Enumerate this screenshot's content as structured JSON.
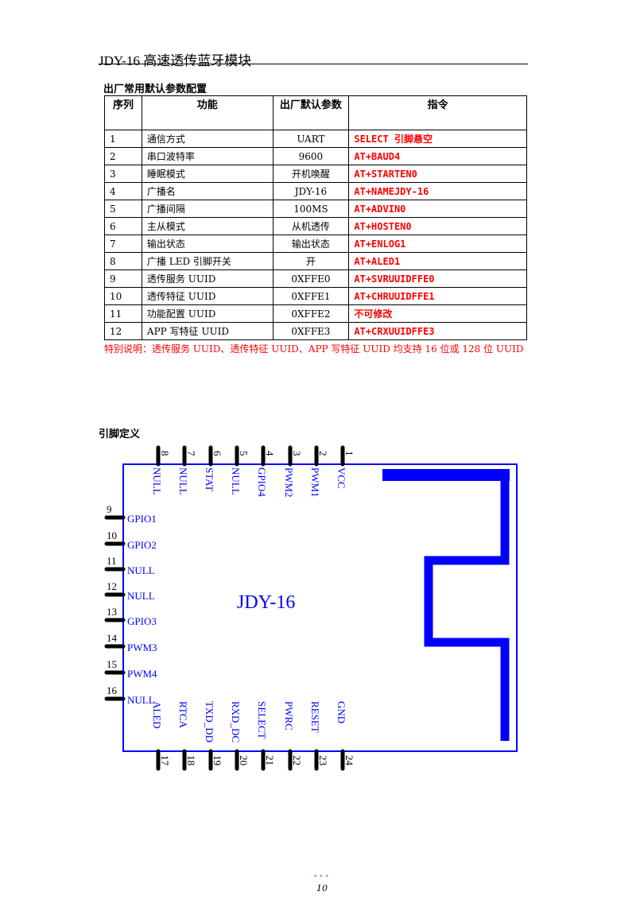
{
  "header": {
    "title": "JDY-16 高速透传蓝牙模块"
  },
  "table_section": {
    "title": "出厂常用默认参数配置",
    "columns": [
      "序列",
      "功能",
      "出厂默认参数",
      "指令"
    ],
    "rows": [
      {
        "num": "1",
        "func": "通信方式",
        "default": "UART",
        "cmd": "SELECT 引脚悬空"
      },
      {
        "num": "2",
        "func": "串口波特率",
        "default": "9600",
        "cmd": "AT+BAUD4"
      },
      {
        "num": "3",
        "func": "睡眠模式",
        "default": "开机唤醒",
        "cmd": "AT+STARTEN0"
      },
      {
        "num": "4",
        "func": "广播名",
        "default": "JDY-16",
        "cmd": "AT+NAMEJDY-16"
      },
      {
        "num": "5",
        "func": "广播间隔",
        "default": "100MS",
        "cmd": "AT+ADVIN0"
      },
      {
        "num": "6",
        "func": "主从模式",
        "default": "从机透传",
        "cmd": "AT+HOSTEN0"
      },
      {
        "num": "7",
        "func": "输出状态",
        "default": "输出状态",
        "cmd": "AT+ENLOG1"
      },
      {
        "num": "8",
        "func": "广播 LED 引脚开关",
        "default": "开",
        "cmd": "AT+ALED1"
      },
      {
        "num": "9",
        "func": "透传服务 UUID",
        "default": "0XFFE0",
        "cmd": "AT+SVRUUIDFFE0"
      },
      {
        "num": "10",
        "func": "透传特征 UUID",
        "default": "0XFFE1",
        "cmd": "AT+CHRUUIDFFE1"
      },
      {
        "num": "11",
        "func": "功能配置 UUID",
        "default": "0XFFE2",
        "cmd": "不可修改"
      },
      {
        "num": "12",
        "func": "APP 写特征 UUID",
        "default": "0XFFE3",
        "cmd": "AT+CRXUUIDFFE3"
      }
    ],
    "note": "特别说明：透传服务 UUID、透传特征 UUID、APP 写特征 UUID 均支持 16 位或 128 位 UUID"
  },
  "pin_section": {
    "title": "引脚定义",
    "module_label": "JDY-16",
    "top_pins": [
      {
        "num": "8",
        "name": "NULL"
      },
      {
        "num": "7",
        "name": "NULL"
      },
      {
        "num": "6",
        "name": "STAT"
      },
      {
        "num": "5",
        "name": "NULL"
      },
      {
        "num": "4",
        "name": "GPIO4"
      },
      {
        "num": "3",
        "name": "PWM2"
      },
      {
        "num": "2",
        "name": "PWM1"
      },
      {
        "num": "1",
        "name": "VCC"
      }
    ],
    "left_pins": [
      {
        "num": "9",
        "name": "GPIO1"
      },
      {
        "num": "10",
        "name": "GPIO2"
      },
      {
        "num": "11",
        "name": "NULL"
      },
      {
        "num": "12",
        "name": "NULL"
      },
      {
        "num": "13",
        "name": "GPIO3"
      },
      {
        "num": "14",
        "name": "PWM3"
      },
      {
        "num": "15",
        "name": "PWM4"
      },
      {
        "num": "16",
        "name": "NULL"
      }
    ],
    "bottom_pins": [
      {
        "num": "17",
        "name": "ALED"
      },
      {
        "num": "18",
        "name": "RTCA"
      },
      {
        "num": "19",
        "name": "TXD_DD"
      },
      {
        "num": "20",
        "name": "RXD_DC"
      },
      {
        "num": "21",
        "name": "SELECT"
      },
      {
        "num": "22",
        "name": "PWRC"
      },
      {
        "num": "23",
        "name": "RESET"
      },
      {
        "num": "24",
        "name": "GND"
      }
    ],
    "colors": {
      "outline": "#0000ff",
      "antenna": "#0000ff",
      "pin": "#000000"
    }
  },
  "footer": {
    "dots": "•••",
    "page_number": "10"
  }
}
